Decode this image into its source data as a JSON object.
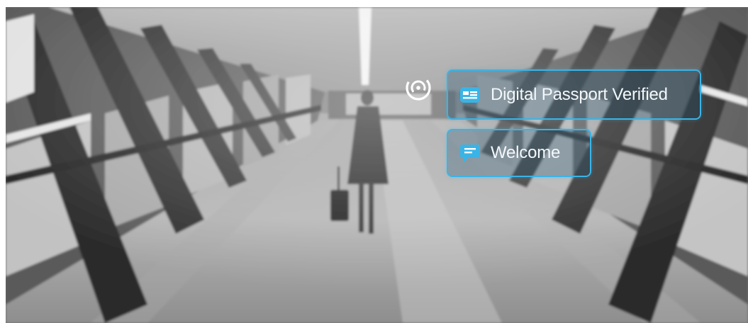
{
  "overlay": {
    "passport_label": "Digital Passport Verified",
    "welcome_label": "Welcome"
  },
  "icons": {
    "scan": "scan-target-icon",
    "passport": "id-card-icon",
    "welcome": "chat-bubble-icon"
  },
  "colors": {
    "accent": "#3ab4e6",
    "text": "#f4f8fb"
  }
}
